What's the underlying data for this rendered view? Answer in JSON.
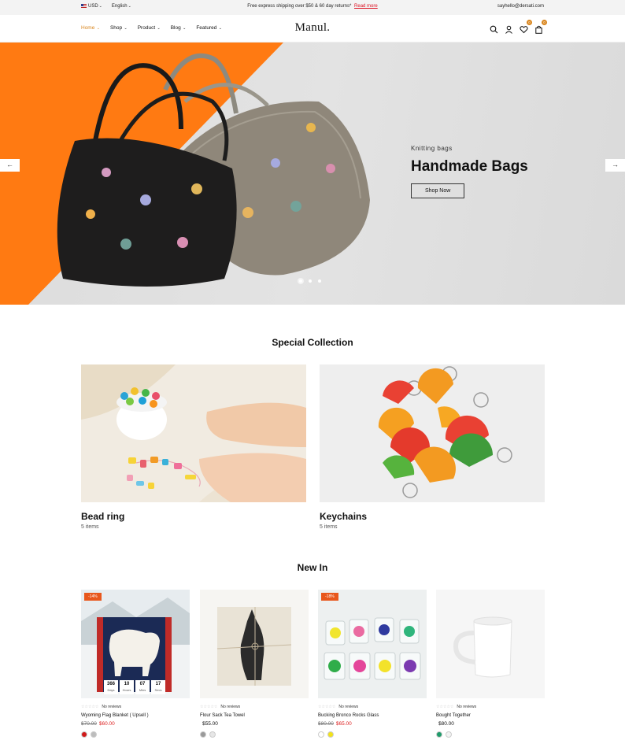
{
  "topbar": {
    "currency": "USD",
    "language": "English",
    "announcement": "Free express shipping over $50 & 60 day returns*",
    "announcement_link": "Read more",
    "email": "sayhello@dersati.com"
  },
  "header": {
    "logo": "Manul.",
    "nav": [
      "Home",
      "Shop",
      "Product",
      "Blog",
      "Featured"
    ],
    "wishlist_count": "0",
    "cart_count": "0"
  },
  "hero": {
    "subtitle": "Knitting bags",
    "title": "Handmade Bags",
    "button": "Shop Now",
    "prev_arrow": "←",
    "next_arrow": "→",
    "slide_count": 3,
    "active_slide": 1
  },
  "special_collection": {
    "title": "Special Collection",
    "items": [
      {
        "name": "Bead ring",
        "count": "5 items"
      },
      {
        "name": "Keychains",
        "count": "5 items"
      }
    ]
  },
  "new_in": {
    "title": "New In",
    "products": [
      {
        "sale": "-14%",
        "reviews": "No reviews",
        "name": "Wyoming Flag Blanket ( Upsell )",
        "old_price": "$70.00",
        "price": "$60.00",
        "swatches": [
          "#d11a1a",
          "#bdbdbd"
        ],
        "countdown": [
          {
            "n": "366",
            "l": "Days"
          },
          {
            "n": "10",
            "l": "Hours"
          },
          {
            "n": "07",
            "l": "Mins"
          },
          {
            "n": "17",
            "l": "Secs"
          }
        ]
      },
      {
        "sale": "",
        "reviews": "No reviews",
        "name": "Flour Sack Tea Towel",
        "old_price": "",
        "price": "$55.00",
        "swatches": [
          "#9a9a9a",
          "#e6e6e6"
        ]
      },
      {
        "sale": "-18%",
        "reviews": "No reviews",
        "name": "Bucking Bronco Rocks Glass",
        "old_price": "$80.00",
        "price": "$65.00",
        "swatches": [
          "#ffffff",
          "#f2e21a"
        ]
      },
      {
        "sale": "",
        "reviews": "No reviews",
        "name": "Bought Together",
        "old_price": "",
        "price": "$80.00",
        "swatches": [
          "#1f9b6b",
          "#f3f3f3"
        ]
      }
    ]
  },
  "colors": {
    "accent": "#d9861e",
    "hero_orange": "#ff7a12",
    "sale_badge": "#e8571c",
    "sale_price": "#d22222"
  }
}
